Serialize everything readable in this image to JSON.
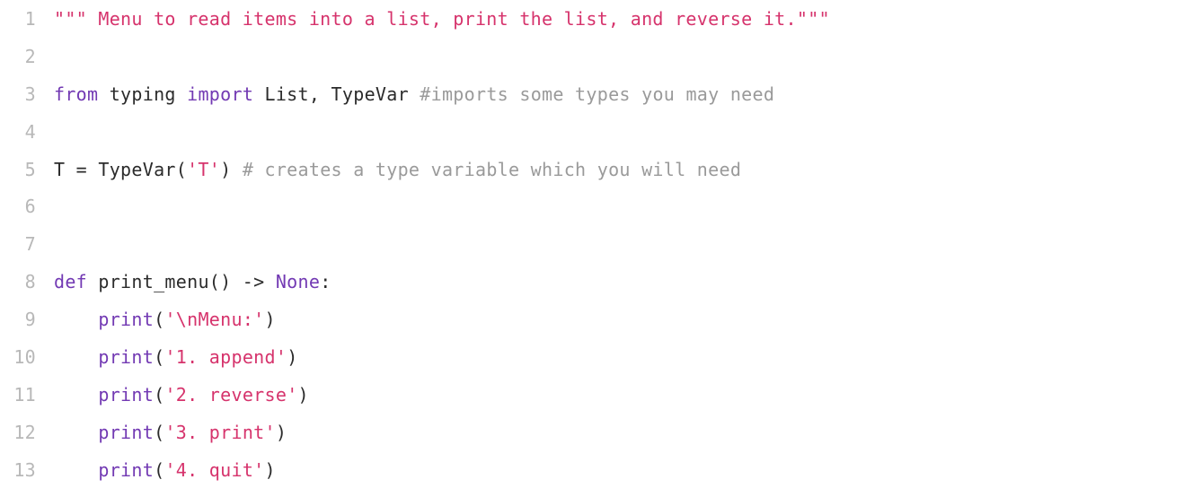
{
  "editor": {
    "language": "python",
    "colors": {
      "string": "#d6336c",
      "keyword": "#7239b3",
      "comment": "#9a9a9a",
      "plain": "#2b2b2b",
      "line_number": "#b8b8b8",
      "background": "#ffffff"
    },
    "lines": [
      {
        "number": "1",
        "tokens": [
          {
            "type": "string",
            "text": "\"\"\" Menu to read items into a list, print the list, and reverse it.\"\"\""
          }
        ]
      },
      {
        "number": "2",
        "tokens": []
      },
      {
        "number": "3",
        "tokens": [
          {
            "type": "keyword",
            "text": "from"
          },
          {
            "type": "plain",
            "text": " typing "
          },
          {
            "type": "keyword",
            "text": "import"
          },
          {
            "type": "plain",
            "text": " List, TypeVar "
          },
          {
            "type": "comment",
            "text": "#imports some types you may need"
          }
        ]
      },
      {
        "number": "4",
        "tokens": []
      },
      {
        "number": "5",
        "tokens": [
          {
            "type": "plain",
            "text": "T = TypeVar("
          },
          {
            "type": "string",
            "text": "'T'"
          },
          {
            "type": "plain",
            "text": ") "
          },
          {
            "type": "comment",
            "text": "# creates a type variable which you will need"
          }
        ]
      },
      {
        "number": "6",
        "tokens": []
      },
      {
        "number": "7",
        "tokens": []
      },
      {
        "number": "8",
        "tokens": [
          {
            "type": "keyword",
            "text": "def"
          },
          {
            "type": "plain",
            "text": " print_menu() -> "
          },
          {
            "type": "keyword",
            "text": "None"
          },
          {
            "type": "plain",
            "text": ":"
          }
        ]
      },
      {
        "number": "9",
        "tokens": [
          {
            "type": "plain",
            "text": "    "
          },
          {
            "type": "builtin",
            "text": "print"
          },
          {
            "type": "plain",
            "text": "("
          },
          {
            "type": "string",
            "text": "'\\nMenu:'"
          },
          {
            "type": "plain",
            "text": ")"
          }
        ]
      },
      {
        "number": "10",
        "tokens": [
          {
            "type": "plain",
            "text": "    "
          },
          {
            "type": "builtin",
            "text": "print"
          },
          {
            "type": "plain",
            "text": "("
          },
          {
            "type": "string",
            "text": "'1. append'"
          },
          {
            "type": "plain",
            "text": ")"
          }
        ]
      },
      {
        "number": "11",
        "tokens": [
          {
            "type": "plain",
            "text": "    "
          },
          {
            "type": "builtin",
            "text": "print"
          },
          {
            "type": "plain",
            "text": "("
          },
          {
            "type": "string",
            "text": "'2. reverse'"
          },
          {
            "type": "plain",
            "text": ")"
          }
        ]
      },
      {
        "number": "12",
        "tokens": [
          {
            "type": "plain",
            "text": "    "
          },
          {
            "type": "builtin",
            "text": "print"
          },
          {
            "type": "plain",
            "text": "("
          },
          {
            "type": "string",
            "text": "'3. print'"
          },
          {
            "type": "plain",
            "text": ")"
          }
        ]
      },
      {
        "number": "13",
        "tokens": [
          {
            "type": "plain",
            "text": "    "
          },
          {
            "type": "builtin",
            "text": "print"
          },
          {
            "type": "plain",
            "text": "("
          },
          {
            "type": "string",
            "text": "'4. quit'"
          },
          {
            "type": "plain",
            "text": ")"
          }
        ]
      }
    ]
  }
}
